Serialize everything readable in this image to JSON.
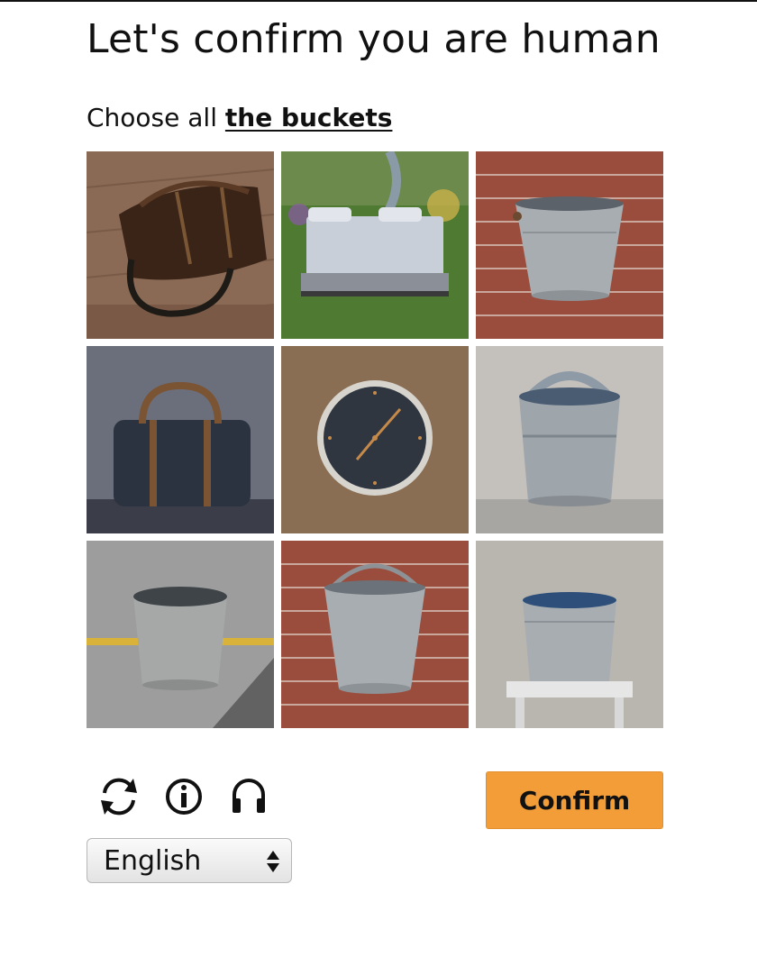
{
  "header": {
    "title": "Let's confirm you are human"
  },
  "instruction": {
    "prefix": "Choose all ",
    "target": "the buckets"
  },
  "grid": {
    "tiles": [
      {
        "subject": "leather-bag",
        "selected": false
      },
      {
        "subject": "bed-on-grass",
        "selected": false
      },
      {
        "subject": "bucket-on-brick-wall",
        "selected": false
      },
      {
        "subject": "duffel-bag",
        "selected": false
      },
      {
        "subject": "wall-clock",
        "selected": false
      },
      {
        "subject": "bucket-with-handle",
        "selected": false
      },
      {
        "subject": "bucket-on-pavement",
        "selected": false
      },
      {
        "subject": "bucket-hanging-on-brick",
        "selected": false
      },
      {
        "subject": "bucket-on-stool",
        "selected": false
      }
    ]
  },
  "controls": {
    "icons": [
      "refresh-icon",
      "info-icon",
      "audio-icon"
    ],
    "confirm_label": "Confirm",
    "confirm_color": "#f29d38"
  },
  "language": {
    "selected": "English"
  }
}
